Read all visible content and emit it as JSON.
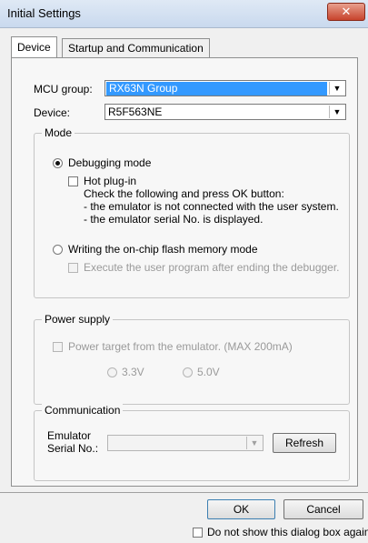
{
  "window": {
    "title": "Initial Settings",
    "close_glyph": "✕"
  },
  "tabs": [
    {
      "label": "Device"
    },
    {
      "label": "Startup and Communication"
    }
  ],
  "device": {
    "mcu_group_label": "MCU group:",
    "mcu_group_value": "RX63N Group",
    "device_label": "Device:",
    "device_value": "R5F563NE"
  },
  "mode": {
    "title": "Mode",
    "debugging_label": "Debugging mode",
    "hot_plugin_label": "Hot plug-in",
    "hot_plugin_desc1": "Check the following and press OK button:",
    "hot_plugin_desc2": "- the emulator is not connected with the user system.",
    "hot_plugin_desc3": "- the emulator serial No. is displayed.",
    "writing_label": "Writing the on-chip flash memory mode",
    "execute_label": "Execute the user program after ending the debugger."
  },
  "power": {
    "title": "Power supply",
    "target_label": "Power target from the emulator. (MAX 200mA)",
    "v33_label": "3.3V",
    "v50_label": "5.0V"
  },
  "communication": {
    "title": "Communication",
    "serial_label_line1": "Emulator",
    "serial_label_line2": "Serial No.:",
    "serial_value": "",
    "refresh_label": "Refresh"
  },
  "footer": {
    "ok_label": "OK",
    "cancel_label": "Cancel",
    "dont_show_label": "Do not show this dialog box again"
  },
  "colors": {
    "selection": "#3399ff",
    "close_button": "#c7432c",
    "disabled_text": "#9a9a9a"
  }
}
